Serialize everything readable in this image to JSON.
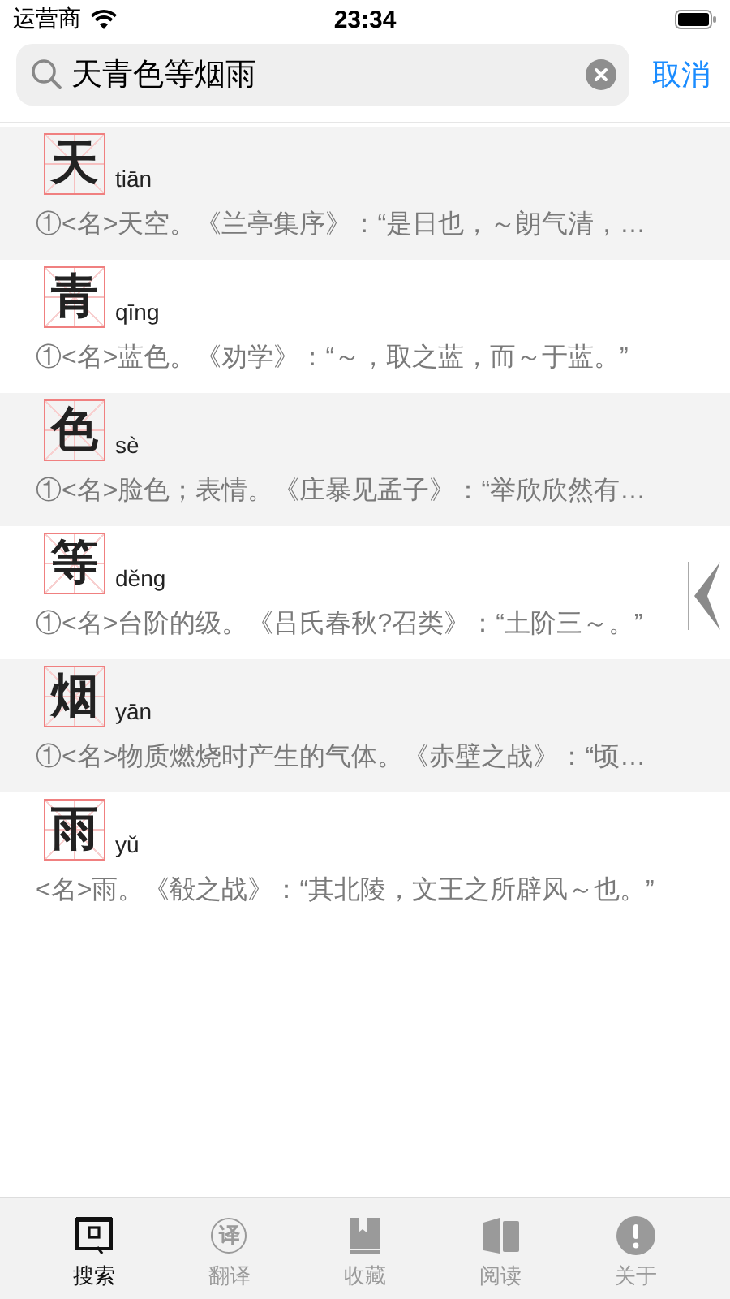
{
  "status_bar": {
    "carrier": "运营商",
    "time": "23:34"
  },
  "search": {
    "value": "天青色等烟雨",
    "cancel": "取消"
  },
  "entries": [
    {
      "character": "天",
      "pinyin": "tiān",
      "definition": "①<名>天空。《兰亭集序》：“是日也，～朗气清，…"
    },
    {
      "character": "青",
      "pinyin": "qīng",
      "definition": "①<名>蓝色。《劝学》：“～，取之蓝，而～于蓝。”"
    },
    {
      "character": "色",
      "pinyin": "sè",
      "definition": "①<名>脸色；表情。《庄暴见孟子》：“举欣欣然有…"
    },
    {
      "character": "等",
      "pinyin": "děng",
      "definition": "①<名>台阶的级。《吕氏春秋?召类》：“土阶三～。”"
    },
    {
      "character": "烟",
      "pinyin": "yān",
      "definition": "①<名>物质燃烧时产生的气体。《赤壁之战》：“顷…"
    },
    {
      "character": "雨",
      "pinyin": "yǔ",
      "definition": "<名>雨。《殽之战》：“其北陵，文王之所辟风～也。”"
    }
  ],
  "tab_bar": [
    {
      "kind": "search",
      "label": "搜索",
      "selected": true
    },
    {
      "kind": "translate",
      "label": "翻译",
      "glyph": "译",
      "selected": false
    },
    {
      "kind": "favorites",
      "label": "收藏",
      "selected": false
    },
    {
      "kind": "read",
      "label": "阅读",
      "selected": false
    },
    {
      "kind": "about",
      "label": "关于",
      "selected": false
    }
  ]
}
